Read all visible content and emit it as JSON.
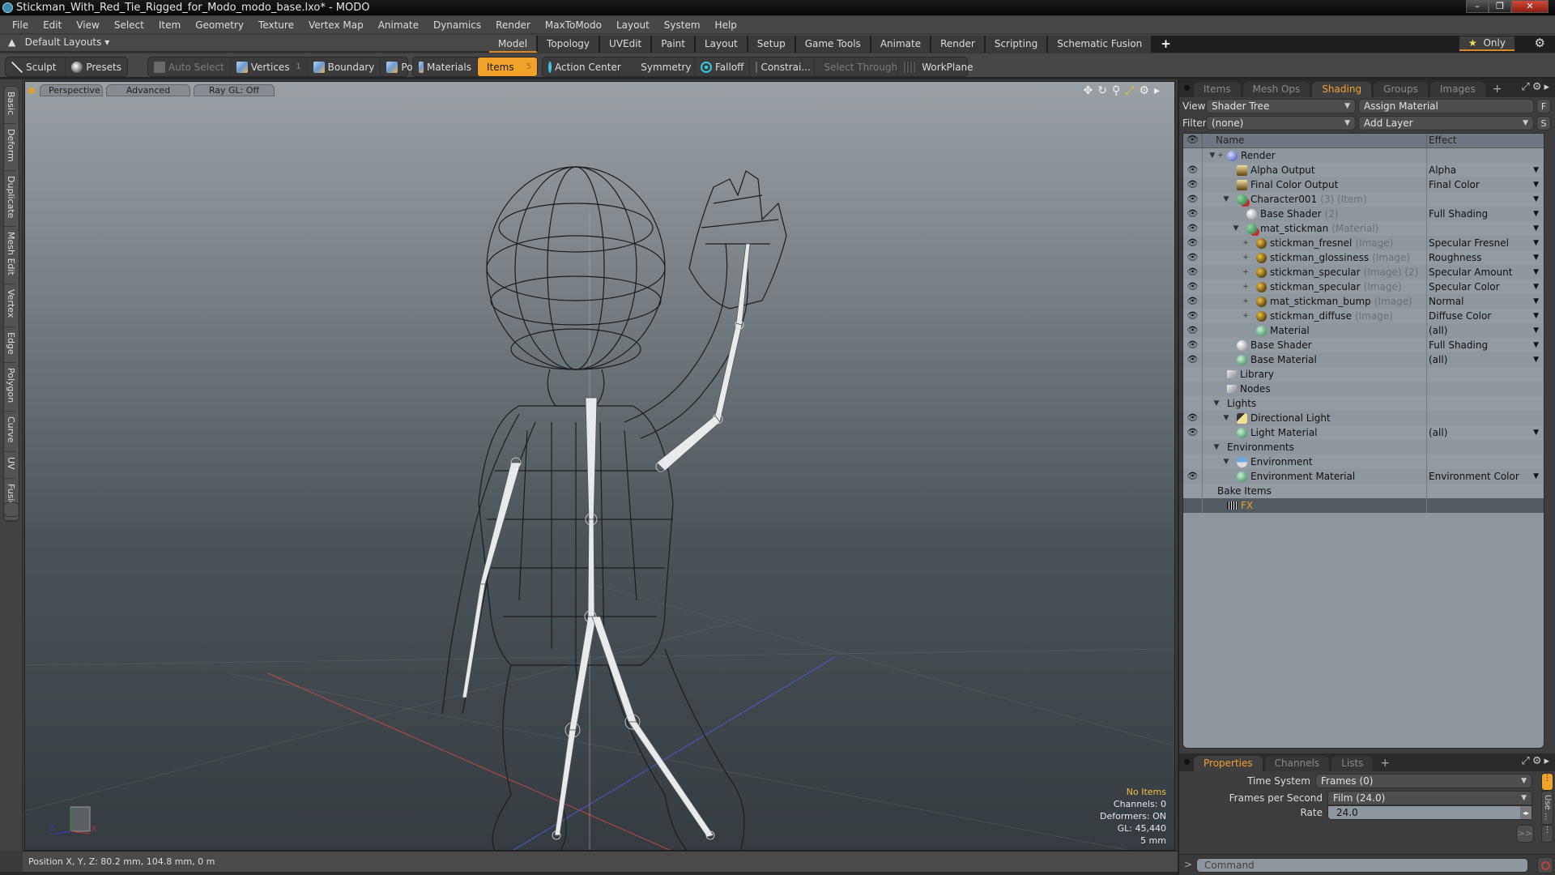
{
  "window": {
    "title": "Stickman_With_Red_Tie_Rigged_for_Modo_modo_base.lxo* - MODO",
    "controls": {
      "minimize": "–",
      "maximize": "❐",
      "close": "✕"
    }
  },
  "menu": [
    "File",
    "Edit",
    "View",
    "Select",
    "Item",
    "Geometry",
    "Texture",
    "Vertex Map",
    "Animate",
    "Dynamics",
    "Render",
    "MaxToModo",
    "Layout",
    "System",
    "Help"
  ],
  "layout_bar": {
    "layouts_label": "Default Layouts ▾",
    "tabs": [
      "Model",
      "Topology",
      "UVEdit",
      "Paint",
      "Layout",
      "Setup",
      "Game Tools",
      "Animate",
      "Render",
      "Scripting",
      "Schematic Fusion"
    ],
    "active_tab": "Model",
    "add_tab": "+",
    "only_label": "Only",
    "only_icon": "★"
  },
  "toolbar": {
    "sculpt": "Sculpt",
    "presets": "Presets",
    "auto_select": "Auto Select",
    "vertices": "Vertices",
    "vertices_count": "1",
    "boundary": "Boundary",
    "polygons": "Polygons",
    "materials": "Materials",
    "items": "Items",
    "items_count": "5",
    "action_center": "Action Center",
    "symmetry": "Symmetry",
    "falloff": "Falloff",
    "constraints": "Constrai...",
    "select_through": "Select Through",
    "workplane": "WorkPlane"
  },
  "left_tabs": [
    "Basic",
    "Deform",
    "Duplicate",
    "Mesh Edit",
    "Vertex",
    "Edge",
    "Polygon",
    "Curve",
    "UV",
    "Fusion"
  ],
  "viewport": {
    "view_mode": "Perspective",
    "shading": "Advanced",
    "raygl": "Ray GL: Off",
    "info": {
      "selection": "No Items",
      "channels": "Channels: 0",
      "deformers": "Deformers: ON",
      "gl": "GL: 45,440",
      "grid": "5 mm"
    },
    "axis_labels": {
      "x": "X",
      "z": "Z"
    }
  },
  "status_bar": "Position X, Y, Z:   80.2 mm, 104.8 mm, 0 m",
  "shading_panel": {
    "tabs": [
      "Items",
      "Mesh Ops",
      "Shading",
      "Groups",
      "Images"
    ],
    "active_tab": "Shading",
    "view_label": "View",
    "view_value": "Shader Tree",
    "assign_material": "Assign Material",
    "f_button": "F",
    "filter_label": "Filter",
    "filter_value": "(none)",
    "add_layer": "Add Layer",
    "s_button": "S",
    "columns": {
      "name": "Name",
      "effect": "Effect"
    },
    "rows": [
      {
        "indent": 0,
        "toggle": "▼ +",
        "icon": "render",
        "name": "Render",
        "suffix": "",
        "effect": "",
        "eye": false,
        "dropdown": false
      },
      {
        "indent": 2,
        "toggle": "",
        "icon": "output",
        "name": "Alpha Output",
        "suffix": "",
        "effect": "Alpha",
        "eye": true,
        "dropdown": true
      },
      {
        "indent": 2,
        "toggle": "",
        "icon": "output",
        "name": "Final Color Output",
        "suffix": "",
        "effect": "Final Color",
        "eye": true,
        "dropdown": true
      },
      {
        "indent": 1,
        "toggle": "▼",
        "icon": "item",
        "name": "Character001",
        "suffix": "(3) (Item)",
        "effect": "",
        "eye": true,
        "dropdown": true
      },
      {
        "indent": 3,
        "toggle": "",
        "icon": "shader",
        "name": "Base Shader",
        "suffix": "(2)",
        "effect": "Full Shading",
        "eye": true,
        "dropdown": true
      },
      {
        "indent": 2,
        "toggle": "▼",
        "icon": "item",
        "name": "mat_stickman",
        "suffix": "(Material)",
        "effect": "",
        "eye": true,
        "dropdown": true
      },
      {
        "indent": 3,
        "toggle": "+",
        "icon": "image",
        "name": "stickman_fresnel",
        "suffix": "(Image)",
        "effect": "Specular Fresnel",
        "eye": true,
        "dropdown": true
      },
      {
        "indent": 3,
        "toggle": "+",
        "icon": "image",
        "name": "stickman_glossiness",
        "suffix": "(Image)",
        "effect": "Roughness",
        "eye": true,
        "dropdown": true
      },
      {
        "indent": 3,
        "toggle": "+",
        "icon": "image",
        "name": "stickman_specular",
        "suffix": "(Image) (2)",
        "effect": "Specular Amount",
        "eye": true,
        "dropdown": true
      },
      {
        "indent": 3,
        "toggle": "+",
        "icon": "image",
        "name": "stickman_specular",
        "suffix": "(Image)",
        "effect": "Specular Color",
        "eye": true,
        "dropdown": true
      },
      {
        "indent": 3,
        "toggle": "+",
        "icon": "image",
        "name": "mat_stickman_bump",
        "suffix": "(Image)",
        "effect": "Normal",
        "eye": true,
        "dropdown": true
      },
      {
        "indent": 3,
        "toggle": "+",
        "icon": "image",
        "name": "stickman_diffuse",
        "suffix": "(Image)",
        "effect": "Diffuse Color",
        "eye": true,
        "dropdown": true
      },
      {
        "indent": 4,
        "toggle": "",
        "icon": "material",
        "name": "Material",
        "suffix": "",
        "effect": "(all)",
        "eye": true,
        "dropdown": true
      },
      {
        "indent": 2,
        "toggle": "",
        "icon": "shader",
        "name": "Base Shader",
        "suffix": "",
        "effect": "Full Shading",
        "eye": true,
        "dropdown": true
      },
      {
        "indent": 2,
        "toggle": "",
        "icon": "material",
        "name": "Base Material",
        "suffix": "",
        "effect": "(all)",
        "eye": true,
        "dropdown": true
      },
      {
        "indent": 1,
        "toggle": "",
        "icon": "folder",
        "name": "Library",
        "suffix": "",
        "effect": "",
        "eye": false,
        "dropdown": false
      },
      {
        "indent": 1,
        "toggle": "",
        "icon": "folder",
        "name": "Nodes",
        "suffix": "",
        "effect": "",
        "eye": false,
        "dropdown": false
      },
      {
        "indent": 0,
        "toggle": "▼",
        "icon": "",
        "name": "Lights",
        "suffix": "",
        "effect": "",
        "eye": false,
        "dropdown": false
      },
      {
        "indent": 1,
        "toggle": "▼",
        "icon": "light",
        "name": "Directional Light",
        "suffix": "",
        "effect": "",
        "eye": true,
        "dropdown": false
      },
      {
        "indent": 2,
        "toggle": "",
        "icon": "material",
        "name": "Light Material",
        "suffix": "",
        "effect": "(all)",
        "eye": true,
        "dropdown": true
      },
      {
        "indent": 0,
        "toggle": "▼",
        "icon": "",
        "name": "Environments",
        "suffix": "",
        "effect": "",
        "eye": false,
        "dropdown": false
      },
      {
        "indent": 1,
        "toggle": "▼",
        "icon": "env",
        "name": "Environment",
        "suffix": "",
        "effect": "",
        "eye": false,
        "dropdown": false
      },
      {
        "indent": 2,
        "toggle": "",
        "icon": "material",
        "name": "Environment Material",
        "suffix": "",
        "effect": "Environment Color",
        "eye": true,
        "dropdown": true
      },
      {
        "indent": 0,
        "toggle": "",
        "icon": "",
        "name": "Bake Items",
        "suffix": "",
        "effect": "",
        "eye": false,
        "dropdown": false
      },
      {
        "indent": 1,
        "toggle": "",
        "icon": "fx",
        "name": "FX",
        "suffix": "",
        "effect": "",
        "eye": false,
        "dropdown": false,
        "selected": true
      }
    ]
  },
  "properties_panel": {
    "tabs": [
      "Properties",
      "Channels",
      "Lists"
    ],
    "active_tab": "Properties",
    "time_system_label": "Time System",
    "time_system_value": "Frames (0)",
    "fps_label": "Frames per Second",
    "fps_value": "Film (24.0)",
    "rate_label": "Rate",
    "rate_value": "24.0",
    "more_button": ">>",
    "side_tab": "Use ...",
    "command_placeholder": "Command",
    "command_prompt": ">"
  },
  "colors": {
    "accent": "#f0a22a",
    "viewport_top": "#9aa1a6",
    "viewport_bottom": "#353c41",
    "tree_bg": "#8f979e"
  }
}
